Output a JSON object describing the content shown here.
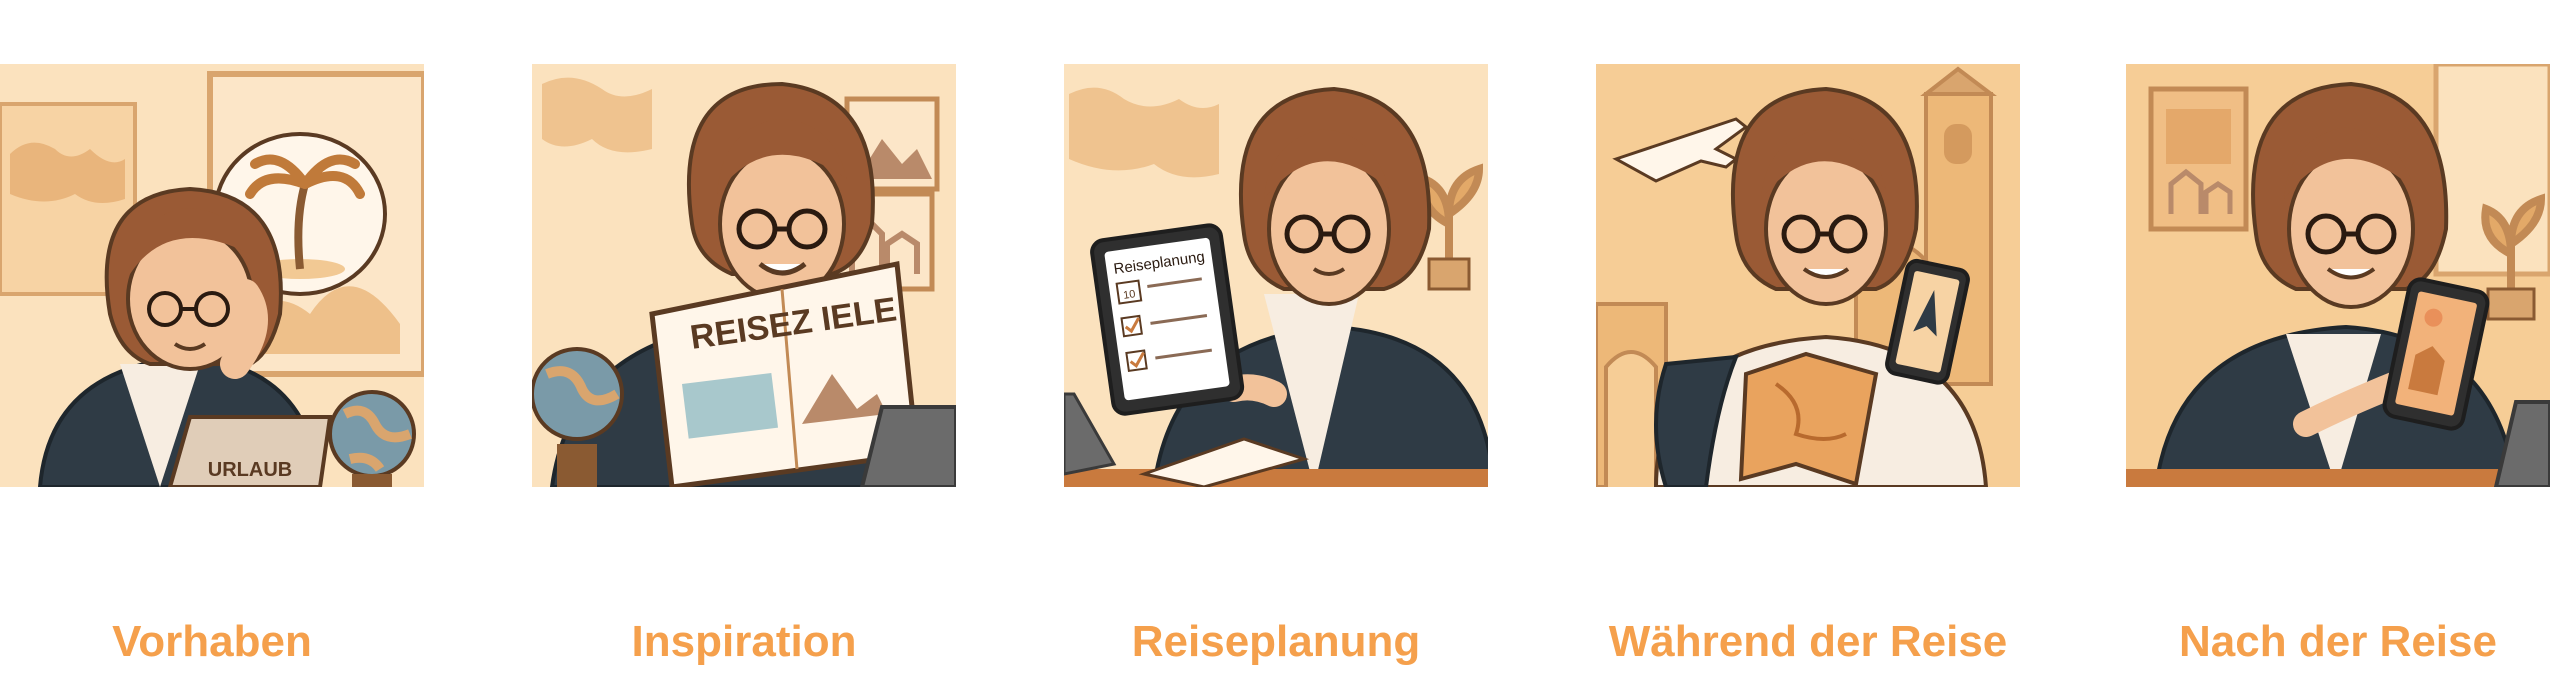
{
  "theme": {
    "accent": "#F5A04C",
    "bg_light": "#FBE2BE",
    "bg_mid": "#F4C892",
    "outline": "#5A3A22",
    "jacket": "#2F3B45",
    "hair": "#9A5A35",
    "skin": "#F2C29A"
  },
  "steps": [
    {
      "caption": "Vorhaben",
      "scene": "daydream",
      "laptop_sticker": "URLAUB"
    },
    {
      "caption": "Inspiration",
      "scene": "magazine",
      "magazine_title": "REISEZ IELE"
    },
    {
      "caption": "Reiseplanung",
      "scene": "tablet",
      "tablet_title": "Reiseplanung",
      "calendar_day": "10"
    },
    {
      "caption": "Während der Reise",
      "scene": "travel"
    },
    {
      "caption": "Nach der Reise",
      "scene": "photos"
    }
  ]
}
